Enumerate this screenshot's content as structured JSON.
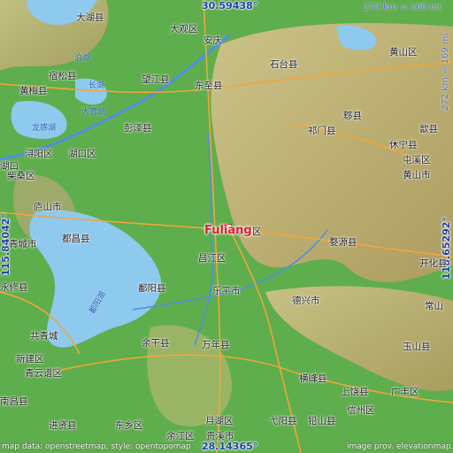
{
  "map": {
    "focus": {
      "name": "Fuliang"
    },
    "coordinates": {
      "top": "30.59438°",
      "bottom": "28.14365°",
      "left": "115.84042°",
      "right": "118.65292°"
    },
    "scale": {
      "horizontal": "273 km = 169 mi",
      "vertical": "272 km = 169 mi"
    },
    "attribution": {
      "left": "map data: openstreetmap, style: opentopomap",
      "right": "image prov. elevationmap.info"
    },
    "water_labels": [
      "长湖",
      "大官湖",
      "泊湖",
      "龙感湖",
      "鄱阳湖"
    ],
    "places": [
      "大湖县",
      "大观区",
      "安庆",
      "黄山区",
      "宿松县",
      "望江县",
      "东至县",
      "石台县",
      "黄梅县",
      "彭泽县",
      "黟县",
      "歙县",
      "祁门县",
      "休宁县",
      "屯溪区",
      "黄山市",
      "浔阳区",
      "湖口区",
      "柴桑区",
      "庐山市",
      "昌江区",
      "婺源县",
      "开化县",
      "青城市",
      "都昌县",
      "永修县",
      "鄱阳县",
      "乐平市",
      "德兴市",
      "常山",
      "余干县",
      "万年县",
      "玉山县",
      "横峰县",
      "上饶县",
      "广丰区",
      "东乡区",
      "月湖区",
      "弋阳县",
      "铅山县",
      "信州区",
      "余江区",
      "贵溪市",
      "进贤县",
      "南昌县",
      "新建区",
      "青云谱区",
      "珠山区",
      "共青城",
      "湖口"
    ],
    "colors": {
      "lowland": "#5fae4d",
      "highland": "#c9b27a",
      "lake": "#8ec9ee",
      "road": "#f0a63a",
      "focus": "#e02020",
      "coord_text": "#1e3fa8"
    }
  }
}
